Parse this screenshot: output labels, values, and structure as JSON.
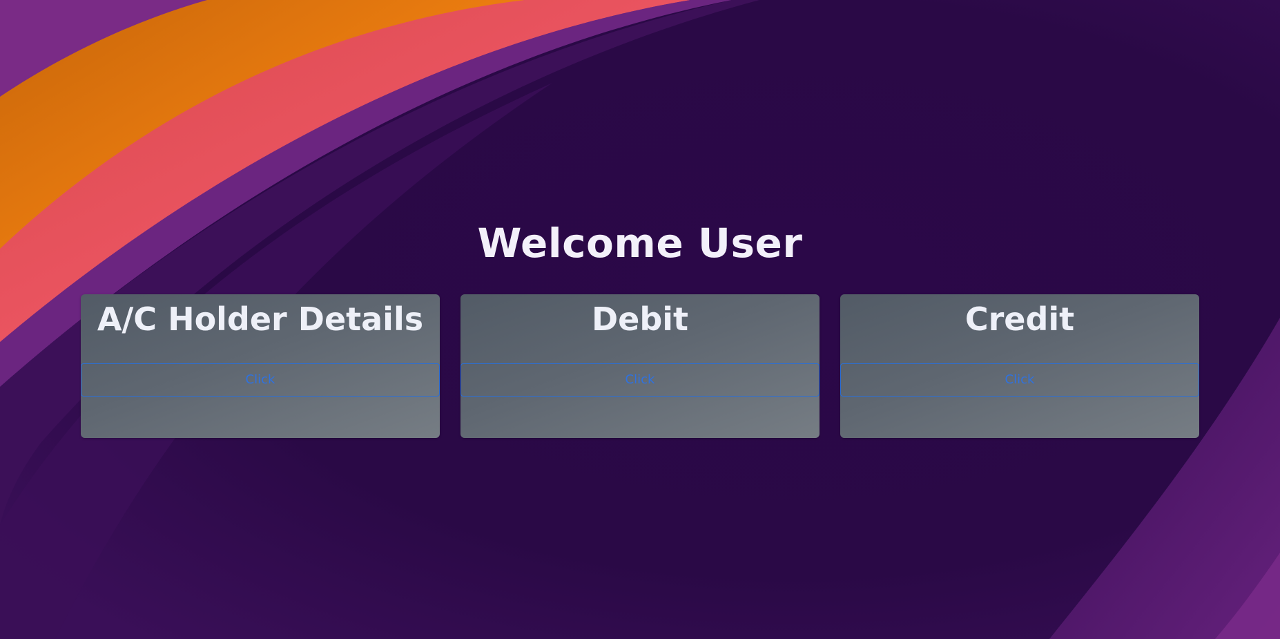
{
  "page": {
    "title": "Welcome User"
  },
  "cards": [
    {
      "title": "A/C Holder Details",
      "button_label": "Click"
    },
    {
      "title": "Debit",
      "button_label": "Click"
    },
    {
      "title": "Credit",
      "button_label": "Click"
    }
  ],
  "colors": {
    "background": "#2c0a4a",
    "card_background": "#5f6771",
    "button_border": "#2a6fd8",
    "button_text": "#2f72e0",
    "title_text": "#f3f0fa"
  }
}
